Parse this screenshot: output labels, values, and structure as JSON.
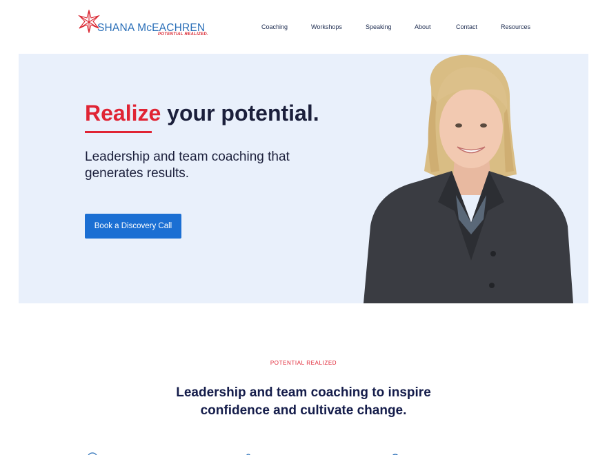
{
  "brand": {
    "name_first": "SHANA",
    "name_last": "McEACHREN",
    "tagline": "POTENTIAL REALIZED.",
    "primary_color": "#2a6fb8",
    "accent_color": "#d9232e",
    "logo_icon": "star-burst-icon"
  },
  "nav": {
    "items": [
      {
        "label": "Coaching"
      },
      {
        "label": "Workshops"
      },
      {
        "label": "Speaking"
      },
      {
        "label": "About"
      },
      {
        "label": "Contact"
      },
      {
        "label": "Resources"
      }
    ]
  },
  "hero": {
    "title_accent": "Realize",
    "title_rest": " your potential.",
    "subtitle": "Leadership and team coaching that generates results.",
    "cta_label": "Book a Discovery Call",
    "background_color": "#e9f0fb",
    "cta_color": "#1b6fd3"
  },
  "section": {
    "eyebrow": "POTENTIAL REALIZED",
    "headline": "Leadership and team coaching to inspire confidence and cultivate change."
  }
}
